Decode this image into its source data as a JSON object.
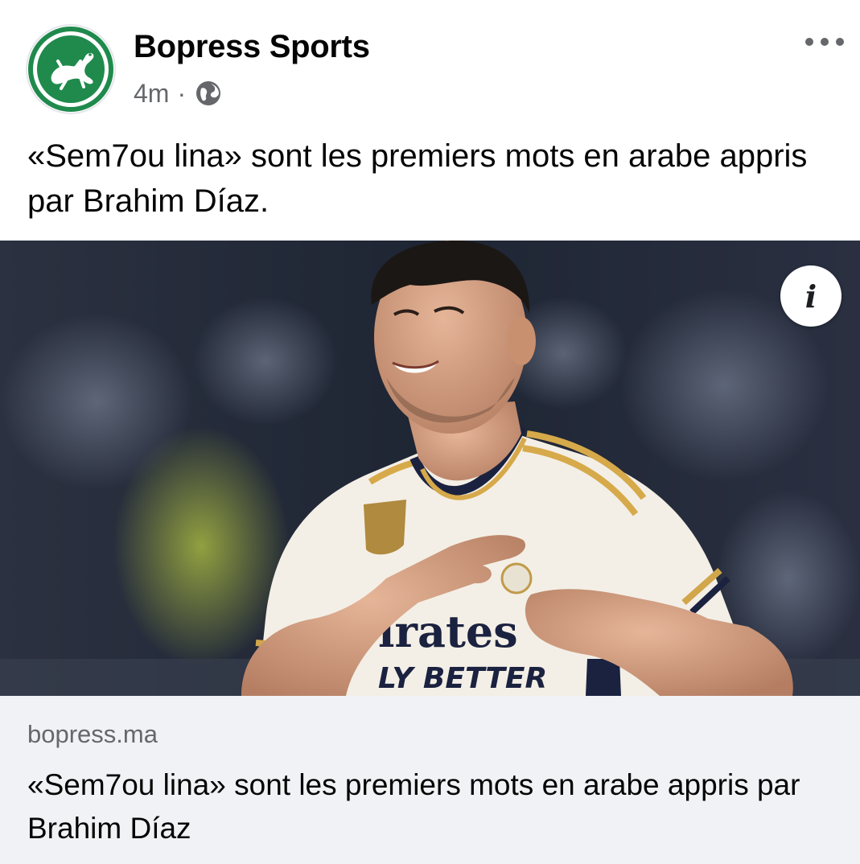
{
  "post": {
    "page_name": "Bopress Sports",
    "timestamp": "4m",
    "separator": "·",
    "audience_icon": "globe-icon",
    "more_icon": "more-options-icon",
    "caption": "«Sem7ou lina» sont les premiers mots en arabe appris par Brahim Díaz."
  },
  "media": {
    "info_icon_label": "i",
    "jersey_text_line1": "ırates",
    "jersey_text_line2": "LY BETTER"
  },
  "link_preview": {
    "domain": "bopress.ma",
    "title": "«Sem7ou lina» sont les premiers mots en arabe appris par Brahim Díaz"
  },
  "colors": {
    "brand_green": "#1f8a4c",
    "meta_gray": "#65676b",
    "link_bg": "#f0f2f5"
  }
}
